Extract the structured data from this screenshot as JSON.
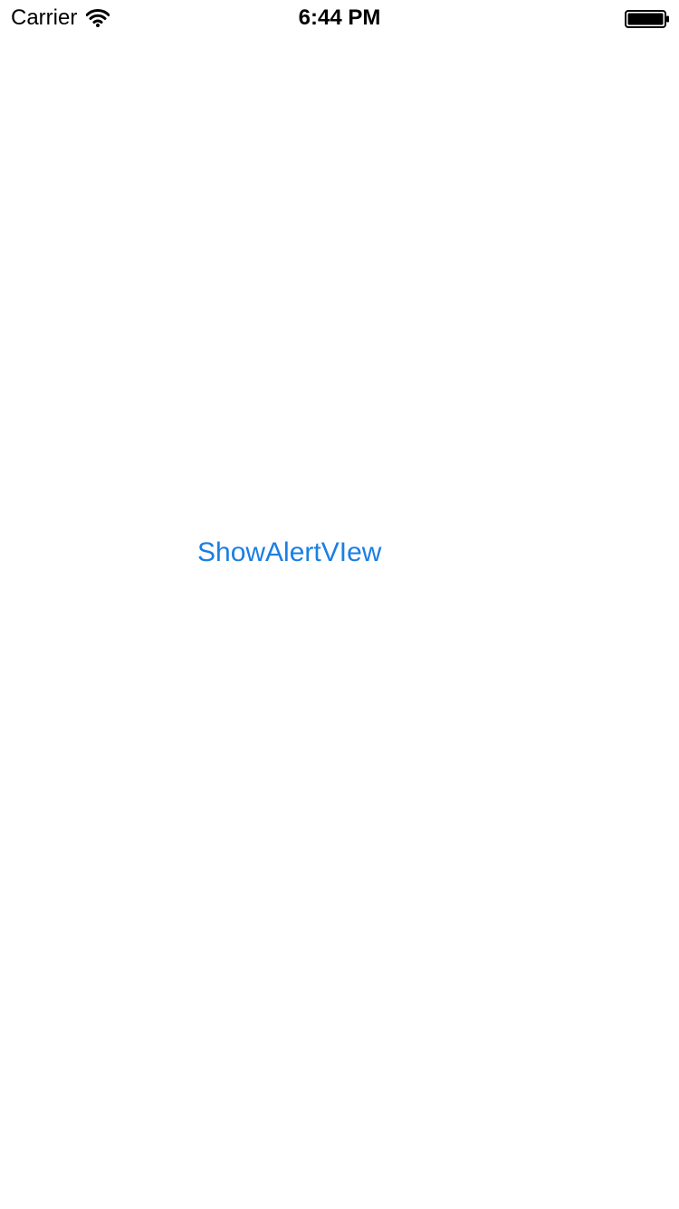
{
  "status_bar": {
    "carrier": "Carrier",
    "time": "6:44 PM",
    "wifi_icon": "wifi-icon",
    "battery_icon": "battery-icon"
  },
  "main": {
    "show_alert_label": "ShowAlertVIew"
  },
  "colors": {
    "accent": "#1a7fe4",
    "background": "#ffffff",
    "status_text": "#000000"
  }
}
